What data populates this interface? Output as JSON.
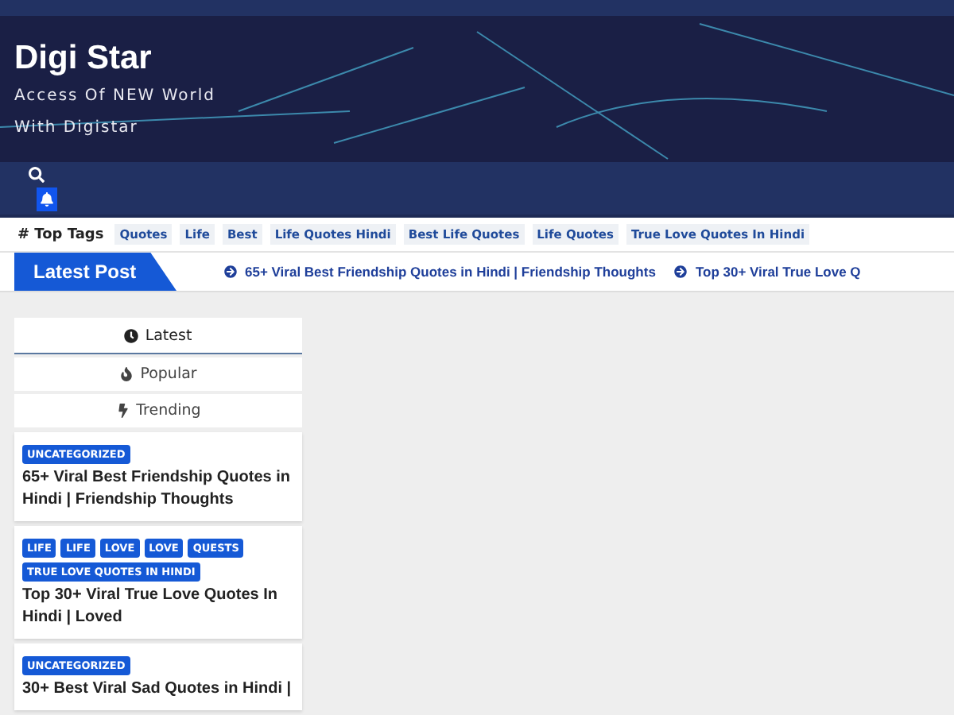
{
  "header": {
    "site_title": "Digi Star",
    "tagline_lines": [
      "Access Of NEW World",
      "With Digistar"
    ]
  },
  "top_tags": {
    "label": "# Top Tags",
    "tags": [
      "Quotes",
      "Life",
      "Best",
      "Life Quotes Hindi",
      "Best Life Quotes",
      "Life Quotes",
      "True Love Quotes In Hindi"
    ]
  },
  "latest_post": {
    "label": "Latest Post",
    "items": [
      "65+ Viral Best Friendship Quotes in Hindi | Friendship Thoughts",
      "Top 30+ Viral True Love Q"
    ]
  },
  "sidebar_tabs": [
    {
      "label": "Latest",
      "kind": "latest",
      "selected": true
    },
    {
      "label": "Popular",
      "kind": "popular",
      "selected": false
    },
    {
      "label": "Trending",
      "kind": "trending",
      "selected": false
    }
  ],
  "posts": [
    {
      "categories": [
        "UNCATEGORIZED"
      ],
      "title": "65+ Viral Best Friendship Quotes in Hindi | Friendship Thoughts"
    },
    {
      "categories": [
        "LIFE",
        "LIFE",
        "LOVE",
        "LOVE",
        "QUESTS",
        "TRUE LOVE QUOTES IN HINDI"
      ],
      "title": "Top 30+ Viral True Love Quotes In Hindi | Loved"
    },
    {
      "categories": [
        "UNCATEGORIZED"
      ],
      "title": "30+ Best Viral Sad Quotes in Hindi |"
    }
  ]
}
